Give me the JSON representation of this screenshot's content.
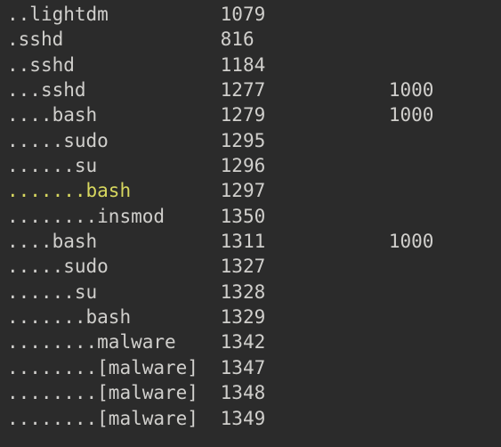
{
  "colors": {
    "bg": "#2b2b2b",
    "fg": "#d0cfcc",
    "highlight": "#d7d75f"
  },
  "rows": [
    {
      "depth": 2,
      "name": "lightdm",
      "pid": "1079",
      "uid": "",
      "hl": false
    },
    {
      "depth": 1,
      "name": "sshd",
      "pid": "816",
      "uid": "",
      "hl": false
    },
    {
      "depth": 2,
      "name": "sshd",
      "pid": "1184",
      "uid": "",
      "hl": false
    },
    {
      "depth": 3,
      "name": "sshd",
      "pid": "1277",
      "uid": "1000",
      "hl": false
    },
    {
      "depth": 4,
      "name": "bash",
      "pid": "1279",
      "uid": "1000",
      "hl": false
    },
    {
      "depth": 5,
      "name": "sudo",
      "pid": "1295",
      "uid": "",
      "hl": false
    },
    {
      "depth": 6,
      "name": "su",
      "pid": "1296",
      "uid": "",
      "hl": false
    },
    {
      "depth": 7,
      "name": "bash",
      "pid": "1297",
      "uid": "",
      "hl": true
    },
    {
      "depth": 8,
      "name": "insmod",
      "pid": "1350",
      "uid": "",
      "hl": false
    },
    {
      "depth": 4,
      "name": "bash",
      "pid": "1311",
      "uid": "1000",
      "hl": false
    },
    {
      "depth": 5,
      "name": "sudo",
      "pid": "1327",
      "uid": "",
      "hl": false
    },
    {
      "depth": 6,
      "name": "su",
      "pid": "1328",
      "uid": "",
      "hl": false
    },
    {
      "depth": 7,
      "name": "bash",
      "pid": "1329",
      "uid": "",
      "hl": false
    },
    {
      "depth": 8,
      "name": "malware",
      "pid": "1342",
      "uid": "",
      "hl": false
    },
    {
      "depth": 8,
      "name": "[malware]",
      "pid": "1347",
      "uid": "",
      "hl": false
    },
    {
      "depth": 8,
      "name": "[malware]",
      "pid": "1348",
      "uid": "",
      "hl": false
    },
    {
      "depth": 8,
      "name": "[malware]",
      "pid": "1349",
      "uid": "",
      "hl": false
    }
  ]
}
